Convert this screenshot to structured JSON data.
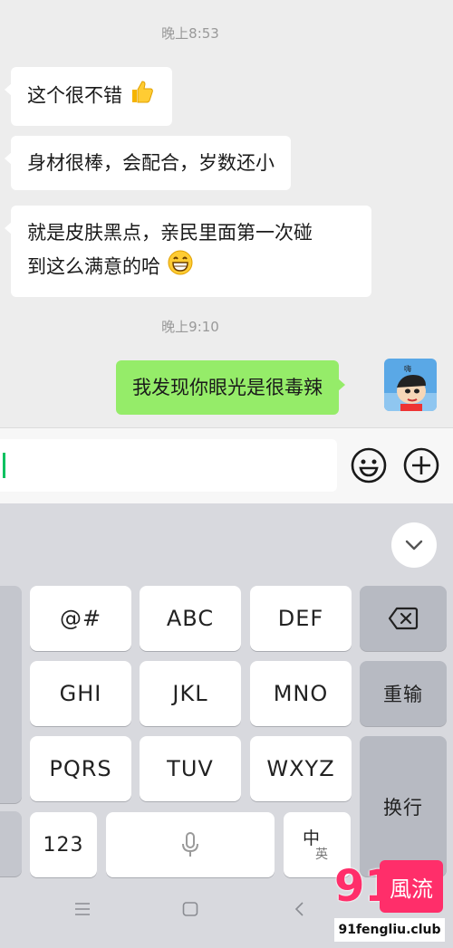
{
  "chat": {
    "timestamp_1": "晚上8:53",
    "messages_received": [
      {
        "text": "这个很不错"
      },
      {
        "text": "身材很棒，会配合，岁数还小"
      },
      {
        "line1": "就是皮肤黑点，亲民里面第一次碰",
        "line2": "到这么满意的哈"
      }
    ],
    "timestamp_2": "晚上9:10",
    "message_sent": "我发现你眼光是很毒辣"
  },
  "input_bar": {
    "value": "",
    "icons": [
      "emoji-icon",
      "plus-icon"
    ]
  },
  "keyboard": {
    "rows": [
      [
        "@#",
        "ABC",
        "DEF"
      ],
      [
        "GHI",
        "JKL",
        "MNO"
      ],
      [
        "PQRS",
        "TUV",
        "WXYZ"
      ]
    ],
    "redo_label": "重输",
    "enter_label": "换行",
    "num_label": "123",
    "lang_primary": "中",
    "lang_secondary": "英"
  },
  "watermark": {
    "number": "91",
    "name": "風流",
    "url": "91fengliu.club"
  },
  "colors": {
    "sent_bubble": "#95ec69",
    "caret": "#07c160",
    "watermark": "#ff2e6a"
  }
}
